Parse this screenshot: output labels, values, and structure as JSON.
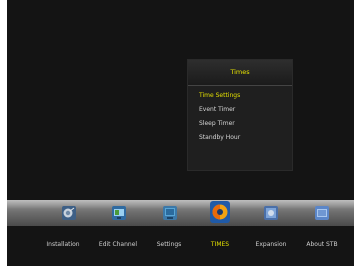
{
  "popup": {
    "title": "Times",
    "items": [
      "Time Settings",
      "Event Timer",
      "Sleep Timer",
      "Standby Hour"
    ],
    "selected_index": 0
  },
  "menu": {
    "items": [
      {
        "label": "Installation",
        "icon": "satellite-dish-icon"
      },
      {
        "label": "Edit Channel",
        "icon": "tv-channel-icon"
      },
      {
        "label": "Settings",
        "icon": "settings-monitor-icon"
      },
      {
        "label": "TIMES",
        "icon": "clock-icon"
      },
      {
        "label": "Expansion",
        "icon": "expansion-icon"
      },
      {
        "label": "About STB",
        "icon": "about-stb-icon"
      }
    ],
    "active_index": 3
  },
  "colors": {
    "highlight": "#e4e000",
    "text": "#d0d0d0",
    "background": "#141414"
  }
}
